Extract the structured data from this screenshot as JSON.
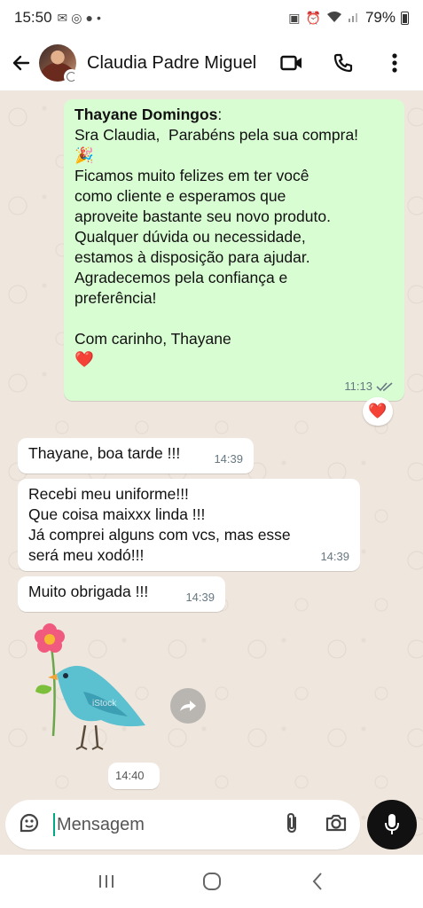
{
  "status_bar": {
    "time": "15:50",
    "battery": "79%"
  },
  "header": {
    "contact_name": "Claudia Padre Miguel"
  },
  "messages": [
    {
      "direction": "outgoing",
      "sender": "Thayane Domingos",
      "lines": [
        "Sra Claudia,  Parabéns pela sua compra!",
        "🎉",
        "Ficamos muito felizes em ter você",
        "como cliente e esperamos que",
        "aproveite bastante seu novo produto.",
        "Qualquer dúvida ou necessidade,",
        "estamos à disposição para ajudar.",
        "Agradecemos pela confiança e",
        "preferência!",
        "",
        "Com carinho, Thayane",
        "❤️"
      ],
      "time": "11:13",
      "reaction": "❤️"
    },
    {
      "direction": "incoming",
      "lines": [
        "Thayane, boa tarde !!!"
      ],
      "time": "14:39"
    },
    {
      "direction": "incoming",
      "lines": [
        "Recebi meu uniforme!!!",
        "Que coisa maixxx linda !!!",
        "Já comprei alguns com vcs, mas esse",
        "será meu xodó!!!"
      ],
      "time": "14:39"
    },
    {
      "direction": "incoming",
      "lines": [
        "Muito obrigada !!!"
      ],
      "time": "14:39"
    },
    {
      "direction": "incoming",
      "type": "sticker",
      "sticker_watermark": "iStock",
      "time": "14:40"
    }
  ],
  "compose": {
    "placeholder": "Mensagem"
  },
  "colors": {
    "outgoing_bubble": "#d9fdd3",
    "incoming_bubble": "#ffffff",
    "chat_background": "#efe7de",
    "accent": "#00a884"
  },
  "icons": {
    "back": "arrow-left-icon",
    "video": "video-camera-icon",
    "call": "phone-icon",
    "menu": "more-vertical-icon",
    "emoji": "sticker-icon",
    "attach": "paperclip-icon",
    "camera": "camera-icon",
    "mic": "microphone-icon"
  }
}
